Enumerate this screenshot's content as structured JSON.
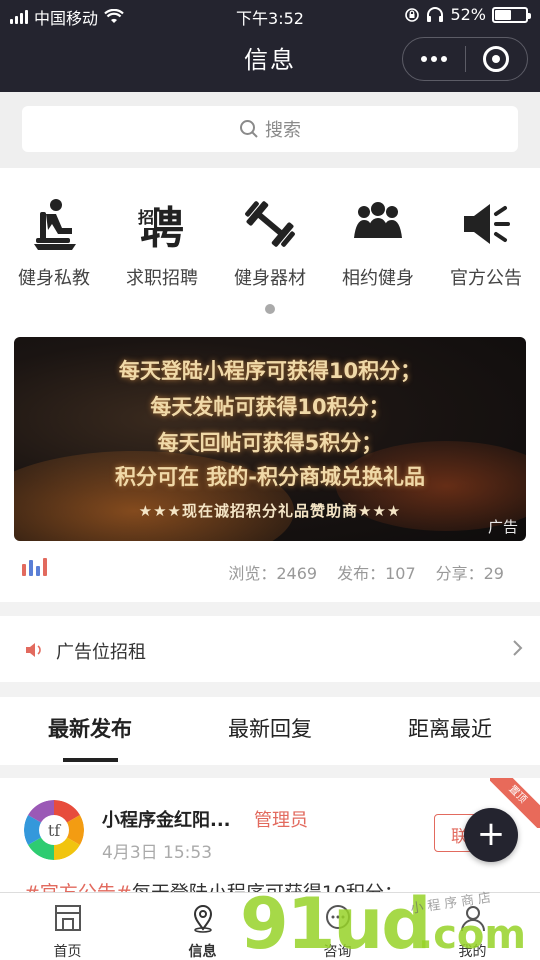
{
  "status_bar": {
    "carrier": "中国移动",
    "time": "下午3:52",
    "battery": "52%",
    "battery_level": 0.52
  },
  "nav": {
    "title": "信息"
  },
  "search": {
    "placeholder": "搜索"
  },
  "categories": [
    {
      "label": "健身私教",
      "icon": "personal-trainer-icon"
    },
    {
      "label": "求职招聘",
      "icon": "recruit-icon",
      "glyph": "聘",
      "glyph_small": "招"
    },
    {
      "label": "健身器材",
      "icon": "dumbbell-icon"
    },
    {
      "label": "相约健身",
      "icon": "group-icon"
    },
    {
      "label": "官方公告",
      "icon": "megaphone-icon"
    }
  ],
  "banner": {
    "lines": [
      "每天登陆小程序可获得10积分；",
      "每天发帖可获得10积分；",
      "每天回帖可获得5积分；",
      "积分可在 我的-积分商城兑换礼品"
    ],
    "stars_line": "★★★现在诚招积分礼品赞助商★★★",
    "ad_label": "广告"
  },
  "stats": {
    "views": "浏览：2469",
    "posts": "发布：107",
    "shares": "分享：29"
  },
  "ad_row": {
    "label": "广告位招租"
  },
  "tabs": [
    {
      "label": "最新发布",
      "active": true
    },
    {
      "label": "最新回复",
      "active": false
    },
    {
      "label": "距离最近",
      "active": false
    }
  ],
  "post": {
    "name": "小程序金红阳...",
    "role": "管理员",
    "date": "4月3日 15:53",
    "contact_label": "联系",
    "corner_label": "置顶",
    "tag": "#官方公告#",
    "excerpt": "每天登陆小程序可获得10积分；",
    "avatar_text": "tf"
  },
  "fab": {
    "label": "+"
  },
  "bottom_nav": [
    {
      "label": "首页",
      "icon": "home-icon",
      "active": false
    },
    {
      "label": "信息",
      "icon": "location-pin-icon",
      "active": true
    },
    {
      "label": "咨询",
      "icon": "chat-icon",
      "active": false
    },
    {
      "label": "我的",
      "icon": "person-icon",
      "active": false
    }
  ],
  "watermark": {
    "big": "91ud",
    "com": ".com",
    "small": "小程序商店"
  },
  "colors": {
    "nav_bg": "#24242f",
    "accent_red": "#e26a5e",
    "banner_text": "#f0d9a8",
    "watermark_green": "#96d228"
  }
}
